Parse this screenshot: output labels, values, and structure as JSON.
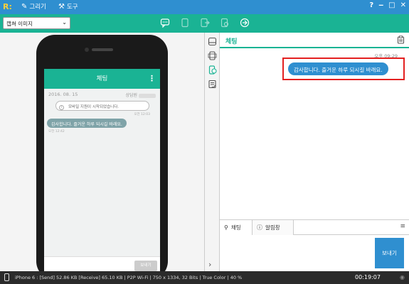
{
  "titlebar": {
    "logo": "R:",
    "menu": [
      {
        "icon": "pencil-icon",
        "label": "그리기"
      },
      {
        "icon": "tools-icon",
        "label": "도구"
      }
    ],
    "controls": {
      "help": "?",
      "minimize": "‒",
      "maximize": "□",
      "close": "✕"
    }
  },
  "toolbar": {
    "capture_select": "캡쳐 이미지",
    "icons": [
      "chat-icon",
      "doc-icon",
      "export-icon",
      "share-icon",
      "link-icon"
    ]
  },
  "phone": {
    "header_title": "체팅",
    "date": "2016. 08. 15",
    "agent_label": "상담원",
    "notice": "모바일 지원이 시작되었습니다.",
    "notice_time": "오전 12:03",
    "message": "감사합니다. 즐거운 하루 되시길 바래요.",
    "message_time": "오전 12:42",
    "send_label": "보내기"
  },
  "side_tabs": [
    "monitor-icon",
    "mobile-icon",
    "mobile-chat-icon",
    "checklist-icon"
  ],
  "chat": {
    "title": "체팅",
    "time": "오후 09:29",
    "message": "감사합니다. 즐거운 하루 되시길 바래요.",
    "tabs": [
      {
        "icon": "search-icon",
        "label": "채팅"
      },
      {
        "icon": "info-icon",
        "label": "알림창"
      }
    ],
    "send_label": "보내기"
  },
  "status": {
    "info": "iPhone 6 : [Send] 52.86 KB  [Receive] 65.10 KB | P2P Wi-Fi | 750 x 1334, 32 Bits | True Color | 40 %",
    "timer": "00:19:07"
  },
  "colors": {
    "accent": "#1ab394",
    "primary": "#2f8fd0",
    "highlight": "#e32020"
  }
}
